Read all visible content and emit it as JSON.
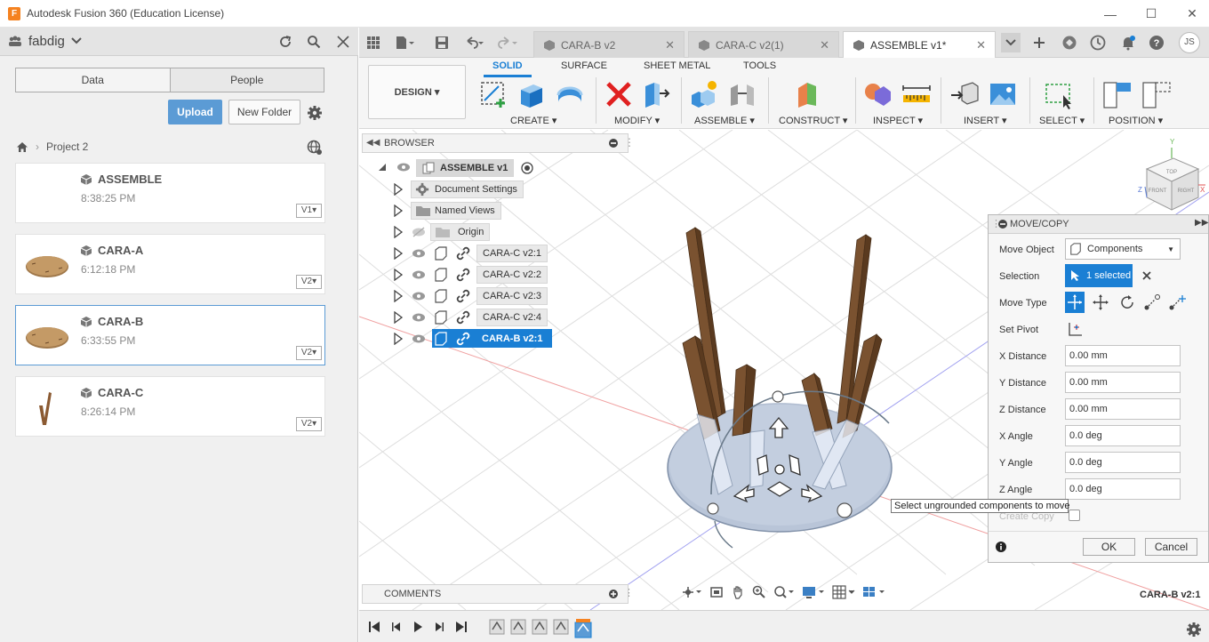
{
  "window": {
    "title": "Autodesk Fusion 360 (Education License)",
    "logo_letter": "F"
  },
  "left_panel": {
    "team_name": "fabdig",
    "tabs": [
      "Data",
      "People"
    ],
    "upload_label": "Upload",
    "new_folder_label": "New Folder",
    "breadcrumb_project": "Project 2",
    "files": [
      {
        "name": "ASSEMBLE",
        "time": "8:38:25 PM",
        "version": "V1"
      },
      {
        "name": "CARA-A",
        "time": "6:12:18 PM",
        "version": "V2"
      },
      {
        "name": "CARA-B",
        "time": "6:33:55 PM",
        "version": "V2"
      },
      {
        "name": "CARA-C",
        "time": "8:26:14 PM",
        "version": "V2"
      }
    ]
  },
  "doc_tabs": [
    {
      "label": "CARA-B v2"
    },
    {
      "label": "CARA-C v2(1)"
    },
    {
      "label": "ASSEMBLE v1*"
    }
  ],
  "user_initials": "JS",
  "toolbar": {
    "workspace": "DESIGN",
    "ws_tabs": [
      "SOLID",
      "SURFACE",
      "SHEET METAL",
      "TOOLS"
    ],
    "groups": [
      "CREATE",
      "MODIFY",
      "ASSEMBLE",
      "CONSTRUCT",
      "INSPECT",
      "INSERT",
      "SELECT",
      "POSITION"
    ]
  },
  "browser": {
    "title": "BROWSER",
    "root": "ASSEMBLE v1",
    "items": [
      "Document Settings",
      "Named Views",
      "Origin",
      "CARA-C v2:1",
      "CARA-C v2:2",
      "CARA-C v2:3",
      "CARA-C v2:4",
      "CARA-B v2:1"
    ]
  },
  "move_copy": {
    "title": "MOVE/COPY",
    "move_object_label": "Move Object",
    "move_object_value": "Components",
    "selection_label": "Selection",
    "selection_value": "1 selected",
    "move_type_label": "Move Type",
    "set_pivot_label": "Set Pivot",
    "fields": [
      {
        "label": "X Distance",
        "value": "0.00 mm"
      },
      {
        "label": "Y Distance",
        "value": "0.00 mm"
      },
      {
        "label": "Z Distance",
        "value": "0.00 mm"
      },
      {
        "label": "X Angle",
        "value": "0.0 deg"
      },
      {
        "label": "Y Angle",
        "value": "0.0 deg"
      },
      {
        "label": "Z Angle",
        "value": "0.0 deg"
      }
    ],
    "create_copy_label": "Create Copy",
    "ok_label": "OK",
    "cancel_label": "Cancel",
    "tooltip": "Select ungrounded components to move"
  },
  "comments_label": "COMMENTS",
  "status_selected": "CARA-B v2:1",
  "viewcube": {
    "top": "TOP",
    "front": "FRONT",
    "right": "RIGHT",
    "axis_x": "X",
    "axis_y": "Y",
    "axis_z": "Z"
  },
  "colors": {
    "accent": "#1a7fd4",
    "upload": "#5b9bd5",
    "wood": "#8b5a32"
  }
}
